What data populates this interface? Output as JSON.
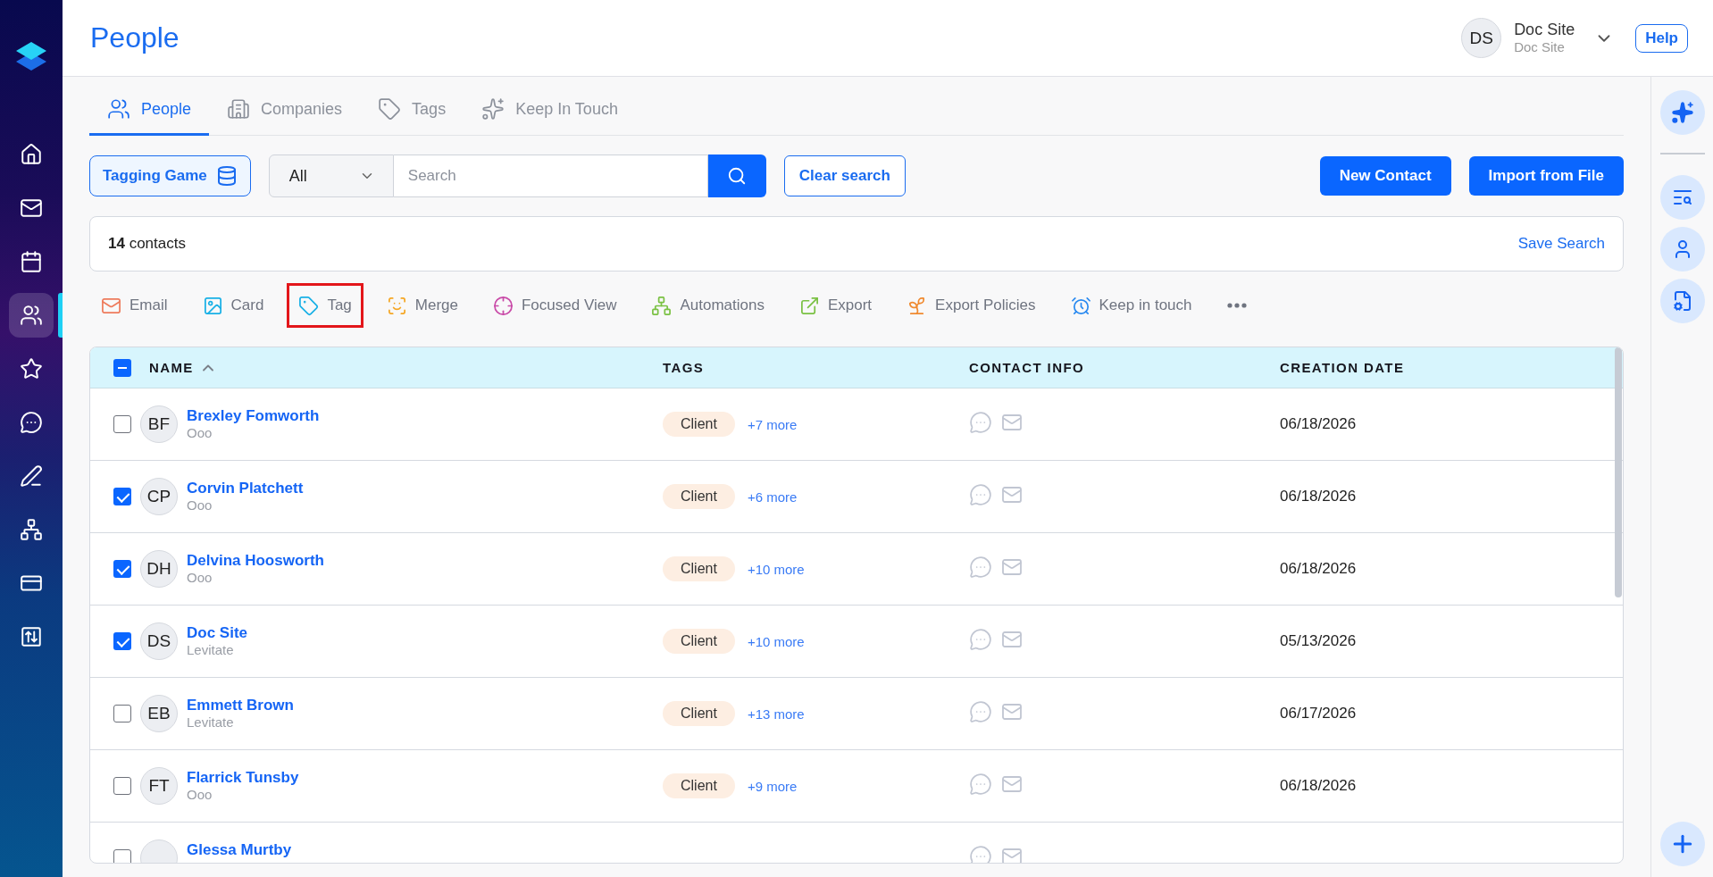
{
  "sidebar": {
    "items": [
      {
        "selected": false
      },
      {
        "selected": false
      },
      {
        "selected": false
      },
      {
        "selected": true
      },
      {
        "selected": false
      },
      {
        "selected": false
      },
      {
        "selected": false
      },
      {
        "selected": false
      },
      {
        "selected": false
      },
      {
        "selected": false
      }
    ]
  },
  "header": {
    "title": "People",
    "user": {
      "initials": "DS",
      "name": "Doc Site",
      "subtitle": "Doc Site"
    },
    "help_button": "Help"
  },
  "tabs": [
    {
      "label": "People",
      "selected": true
    },
    {
      "label": "Companies",
      "selected": false
    },
    {
      "label": "Tags",
      "selected": false
    },
    {
      "label": "Keep In Touch",
      "selected": false
    }
  ],
  "toolbar": {
    "tagging_game_button": "Tagging Game",
    "filter": {
      "value": "All"
    },
    "search": {
      "placeholder": "Search"
    },
    "clear_button": "Clear search",
    "new_contact_button": "New Contact",
    "import_button": "Import from File"
  },
  "summary": {
    "count": "**14** contacts",
    "save_search": "Save Search"
  },
  "actions": [
    {
      "label": "Email",
      "highlighted": false
    },
    {
      "label": "Card",
      "highlighted": false
    },
    {
      "label": "Tag",
      "highlighted": true
    },
    {
      "label": "Merge",
      "highlighted": false
    },
    {
      "label": "Focused View",
      "highlighted": false
    },
    {
      "label": "Automations",
      "highlighted": false
    },
    {
      "label": "Export",
      "highlighted": false
    },
    {
      "label": "Export Policies",
      "highlighted": false
    },
    {
      "label": "Keep in touch",
      "highlighted": false
    }
  ],
  "table": {
    "select_all": {
      "indeterminate": true
    },
    "columns": [
      {
        "label": "NAME",
        "sorted": true
      },
      {
        "label": "TAGS"
      },
      {
        "label": "CONTACT INFO"
      },
      {
        "label": "CREATION DATE"
      }
    ],
    "rows": [
      {
        "checked": false,
        "initials": "BF",
        "name": "Brexley Fomworth",
        "company": "Ooo",
        "tag": "Client",
        "more_tags": "+7 more",
        "created": "06/18/2026"
      },
      {
        "checked": true,
        "initials": "CP",
        "name": "Corvin Platchett",
        "company": "Ooo",
        "tag": "Client",
        "more_tags": "+6 more",
        "created": "06/18/2026"
      },
      {
        "checked": true,
        "initials": "DH",
        "name": "Delvina Hoosworth",
        "company": "Ooo",
        "tag": "Client",
        "more_tags": "+10 more",
        "created": "06/18/2026"
      },
      {
        "checked": true,
        "initials": "DS",
        "name": "Doc Site",
        "company": "Levitate",
        "tag": "Client",
        "more_tags": "+10 more",
        "created": "05/13/2026"
      },
      {
        "checked": false,
        "initials": "EB",
        "name": "Emmett Brown",
        "company": "Levitate",
        "tag": "Client",
        "more_tags": "+13 more",
        "created": "06/17/2026"
      },
      {
        "checked": false,
        "initials": "FT",
        "name": "Flarrick Tunsby",
        "company": "Ooo",
        "tag": "Client",
        "more_tags": "+9 more",
        "created": "06/18/2026"
      },
      {
        "checked": false,
        "name": "Glessa Murtby"
      }
    ]
  }
}
